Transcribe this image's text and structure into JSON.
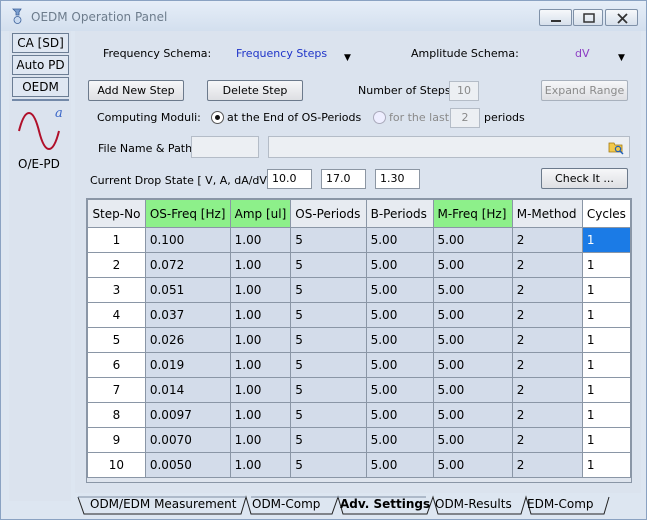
{
  "window": {
    "title": "OEDM Operation Panel"
  },
  "sidebar": {
    "buttons": [
      "CA [SD]",
      "Auto PD",
      "OEDM"
    ],
    "wave_letter": "a",
    "label": "O/E-PD"
  },
  "schema": {
    "frequency_label": "Frequency Schema:",
    "frequency_value": "Frequency Steps",
    "amplitude_label": "Amplitude Schema:",
    "amplitude_value": "dV"
  },
  "controls": {
    "add_step": "Add New Step",
    "delete_step": "Delete Step",
    "num_steps_label": "Number of Steps:",
    "num_steps_value": "10",
    "expand_range": "Expand Range",
    "computing_label": "Computing Moduli:",
    "option_end": "at the End of OS-Periods",
    "option_last": "for the last",
    "last_periods_value": "2",
    "periods_label": "periods",
    "file_label": "File Name & Path:",
    "file_value": "",
    "path_value": "",
    "drop_state_label": "Current Drop State [ V, A, dA/dV ]:",
    "drop_v": "10.0",
    "drop_a": "17.0",
    "drop_dadv": "1.30",
    "check_it": "Check It ..."
  },
  "table": {
    "headers": [
      "Step-No",
      "OS-Freq [Hz]",
      "Amp [ul]",
      "OS-Periods",
      "B-Periods",
      "M-Freq [Hz]",
      "M-Method",
      "Cycles"
    ],
    "rows": [
      [
        "1",
        "0.100",
        "1.00",
        "5",
        "5.00",
        "5.00",
        "2",
        "1"
      ],
      [
        "2",
        "0.072",
        "1.00",
        "5",
        "5.00",
        "5.00",
        "2",
        "1"
      ],
      [
        "3",
        "0.051",
        "1.00",
        "5",
        "5.00",
        "5.00",
        "2",
        "1"
      ],
      [
        "4",
        "0.037",
        "1.00",
        "5",
        "5.00",
        "5.00",
        "2",
        "1"
      ],
      [
        "5",
        "0.026",
        "1.00",
        "5",
        "5.00",
        "5.00",
        "2",
        "1"
      ],
      [
        "6",
        "0.019",
        "1.00",
        "5",
        "5.00",
        "5.00",
        "2",
        "1"
      ],
      [
        "7",
        "0.014",
        "1.00",
        "5",
        "5.00",
        "5.00",
        "2",
        "1"
      ],
      [
        "8",
        "0.0097",
        "1.00",
        "5",
        "5.00",
        "5.00",
        "2",
        "1"
      ],
      [
        "9",
        "0.0070",
        "1.00",
        "5",
        "5.00",
        "5.00",
        "2",
        "1"
      ],
      [
        "10",
        "0.0050",
        "1.00",
        "5",
        "5.00",
        "5.00",
        "2",
        "1"
      ]
    ]
  },
  "tabs": [
    "ODM/EDM Measurement",
    "ODM-Comp",
    "Adv. Settings",
    "ODM-Results",
    "EDM-Comp"
  ],
  "active_tab": "Adv. Settings",
  "colors": {
    "highlight_header": "#8df08a",
    "selection": "#1b7be6",
    "link_blue": "#1f34c8",
    "dv_purple": "#8d3cc4"
  }
}
